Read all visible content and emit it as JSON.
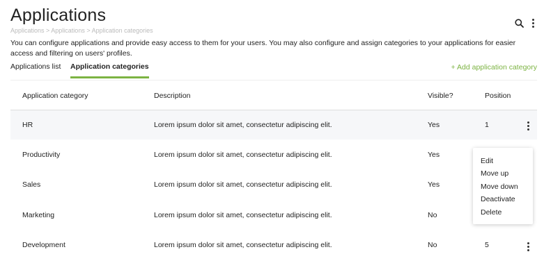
{
  "page": {
    "title": "Applications",
    "breadcrumb": "Applications > Applications > Application categories",
    "intro": "You can configure applications and provide easy access to them for your users. You may also configure and assign categories to your applications for easier access and filtering on users' profiles."
  },
  "header": {
    "icons": [
      "search-icon",
      "more-vertical-icon"
    ]
  },
  "tabs": [
    {
      "label": "Applications list",
      "active": false
    },
    {
      "label": "Application categories",
      "active": true
    }
  ],
  "actions": {
    "add_category": "+ Add application category"
  },
  "table": {
    "columns": [
      "Application category",
      "Description",
      "Visible?",
      "Position"
    ],
    "rows": [
      {
        "name": "HR",
        "description": "Lorem ipsum dolor sit amet, consectetur adipiscing elit.",
        "visible": "Yes",
        "position": "1"
      },
      {
        "name": "Productivity",
        "description": "Lorem ipsum dolor sit amet, consectetur adipiscing elit.",
        "visible": "Yes",
        "position": ""
      },
      {
        "name": "Sales",
        "description": "Lorem ipsum dolor sit amet, consectetur adipiscing elit.",
        "visible": "Yes",
        "position": ""
      },
      {
        "name": "Marketing",
        "description": "Lorem ipsum dolor sit amet, consectetur adipiscing elit.",
        "visible": "No",
        "position": ""
      },
      {
        "name": "Development",
        "description": "Lorem ipsum dolor sit amet, consectetur adipiscing elit.",
        "visible": "No",
        "position": "5"
      }
    ]
  },
  "context_menu": {
    "items": [
      "Edit",
      "Move up",
      "Move down",
      "Deactivate",
      "Delete"
    ]
  },
  "colors": {
    "accent": "#7cb342",
    "row_highlight": "#f6f7f9"
  }
}
